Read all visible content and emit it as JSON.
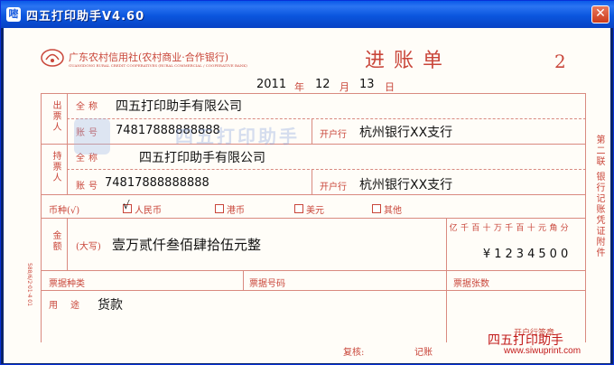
{
  "window": {
    "title": "四五打印助手V4.60",
    "close_label": "✕"
  },
  "bank": {
    "name": "广东农村信用社(农村商业·合作银行)",
    "name_en": "GUANGDONG RURAL CREDIT COOPERATIVES (RURAL COMMERCIAL / COOPERATIVE BANK)"
  },
  "slip": {
    "title": "进账单",
    "copy_no": "2",
    "year": "2011",
    "year_unit": "年",
    "month": "12",
    "month_unit": "月",
    "day": "13",
    "day_unit": "日"
  },
  "payer": {
    "section_label": "出票人",
    "name_label": "全称",
    "name": "四五打印助手有限公司",
    "account_label": "账号",
    "account": "74817888888888",
    "bank_label": "开户行",
    "bank": "杭州银行XX支行"
  },
  "payee": {
    "section_label": "持票人",
    "name_label": "全称",
    "name": "四五打印助手有限公司",
    "account_label": "账号",
    "account": "74817888888888",
    "bank_label": "开户行",
    "bank": "杭州银行XX支行"
  },
  "currency": {
    "label": "币种(√)",
    "options": [
      {
        "label": "人民币",
        "checked": true
      },
      {
        "label": "港币",
        "checked": false
      },
      {
        "label": "美元",
        "checked": false
      },
      {
        "label": "其他",
        "checked": false
      }
    ]
  },
  "amount": {
    "label": "金额",
    "uppercase_label": "(大写)",
    "uppercase": "壹万贰仟叁佰肆拾伍元整",
    "digit_headers": [
      "亿",
      "千",
      "百",
      "十",
      "万",
      "千",
      "百",
      "十",
      "元",
      "角",
      "分"
    ],
    "digits": [
      "",
      "",
      "",
      "¥",
      "1",
      "2",
      "3",
      "4",
      "5",
      "0",
      "0"
    ]
  },
  "footer": {
    "bill_type_label": "票据种类",
    "bill_no_label": "票据号码",
    "bill_count_label": "票据张数",
    "purpose_label": "用途",
    "purpose": "货款",
    "review_label": "复核:",
    "bank_seal_label": "开户行签章",
    "bookkeeping_label": "记账"
  },
  "side_note": "第二联 银行记账凭证附件",
  "left_code": "588/6/2·01·4 01",
  "watermark": {
    "brand": "四五打印助手",
    "url": "www.siwuprint.com"
  },
  "colors": {
    "form_red": "#c9463a",
    "title_blue": "#0a5ae8"
  }
}
